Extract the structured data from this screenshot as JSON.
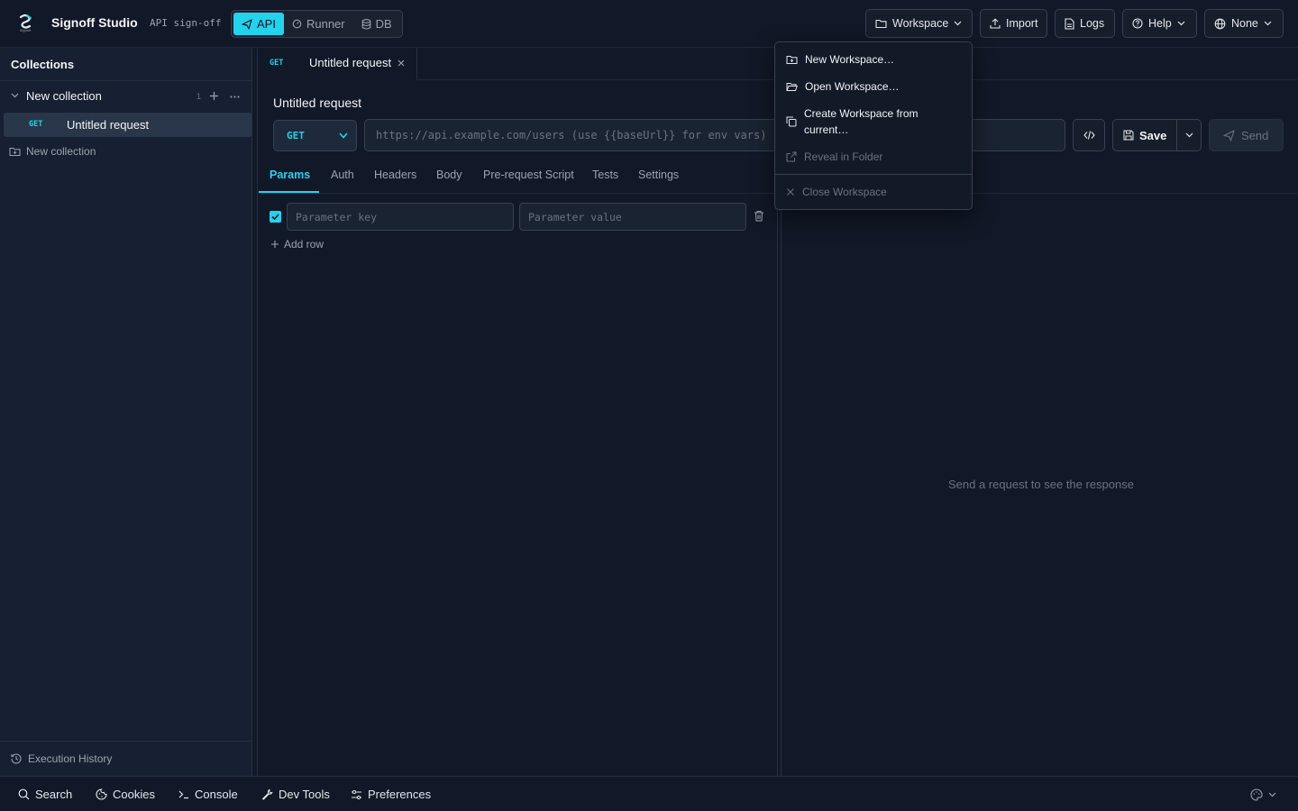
{
  "header": {
    "app_title": "Signoff Studio",
    "app_subtitle": "API sign-off",
    "logo_text": "Signoff",
    "modes": [
      {
        "label": "API",
        "active": true
      },
      {
        "label": "Runner",
        "active": false
      },
      {
        "label": "DB",
        "active": false
      }
    ],
    "buttons": {
      "workspace": "Workspace",
      "import": "Import",
      "logs": "Logs",
      "help": "Help",
      "environment": "None"
    }
  },
  "sidebar": {
    "title": "Collections",
    "collection": {
      "name": "New collection",
      "count": "1"
    },
    "request": {
      "method": "GET",
      "name": "Untitled request"
    },
    "new_collection": "New collection",
    "footer": "Execution History"
  },
  "tab": {
    "method": "GET",
    "name": "Untitled request"
  },
  "request": {
    "title": "Untitled request",
    "method": "GET",
    "url_placeholder": "https://api.example.com/users  (use {{baseUrl}} for env vars)",
    "save_label": "Save",
    "send_label": "Send"
  },
  "subtabs": [
    "Params",
    "Auth",
    "Headers",
    "Body",
    "Pre-request Script",
    "Tests",
    "Settings"
  ],
  "params": {
    "key_placeholder": "Parameter key",
    "value_placeholder": "Parameter value",
    "add_row": "Add row"
  },
  "response": {
    "empty": "Send a request to see the response"
  },
  "statusbar": {
    "items": [
      "Search",
      "Cookies",
      "Console",
      "Dev Tools",
      "Preferences"
    ]
  },
  "workspace_menu": {
    "items": [
      {
        "label": "New Workspace…",
        "disabled": false
      },
      {
        "label": "Open Workspace…",
        "disabled": false
      },
      {
        "label": "Create Workspace from current…",
        "disabled": false
      },
      {
        "label": "Reveal in Folder",
        "disabled": true
      },
      {
        "label": "Close Workspace",
        "disabled": true
      }
    ]
  },
  "colors": {
    "accent": "#22d3ee",
    "background": "#111827",
    "sidebar": "#162032"
  }
}
